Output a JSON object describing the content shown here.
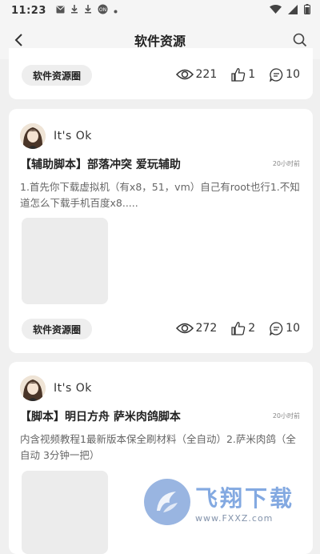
{
  "status_bar": {
    "time": "11:23",
    "icons": [
      "mail-icon",
      "download-icon",
      "download-icon",
      "app-badge-icon",
      "dot-icon"
    ],
    "right_icons": [
      "wifi-icon",
      "signal-icon",
      "battery-icon"
    ]
  },
  "header": {
    "title": "软件资源"
  },
  "posts": [
    {
      "tag": "软件资源圈",
      "views": "221",
      "likes": "1",
      "comments": "10"
    },
    {
      "user": "It's Ok",
      "title_bracket": "【辅助脚本】",
      "title": "部落冲突 爱玩辅助",
      "time": "20小时前",
      "excerpt": "1.首先你下载虚拟机（有x8，51，vm）自己有root也行1.不知道怎么下载手机百度x8.....",
      "tag": "软件资源圈",
      "views": "272",
      "likes": "2",
      "comments": "10"
    },
    {
      "user": "It's Ok",
      "title_bracket": "【脚本】",
      "title": "明日方舟 萨米肉鸽脚本",
      "time": "20小时前",
      "excerpt": "内含视频教程1最新版本保全刷材料（全自动）2.萨米肉鸽（全自动 3分钟一把）"
    }
  ],
  "watermark": {
    "name": "飞翔下载",
    "url": "www.FXXZ.com"
  }
}
